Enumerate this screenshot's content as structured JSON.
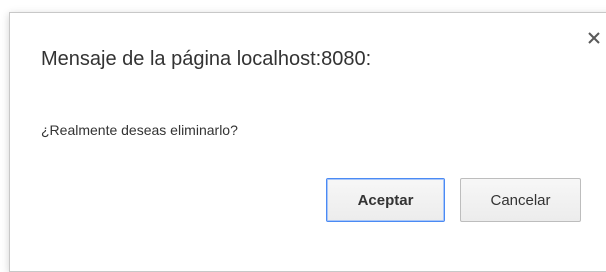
{
  "dialog": {
    "title": "Mensaje de la página localhost:8080:",
    "message": "¿Realmente deseas eliminarlo?",
    "close_icon": "close-icon",
    "buttons": {
      "accept_label": "Aceptar",
      "cancel_label": "Cancelar"
    },
    "colors": {
      "focus_border": "#4a8af4",
      "text": "#333333"
    }
  }
}
